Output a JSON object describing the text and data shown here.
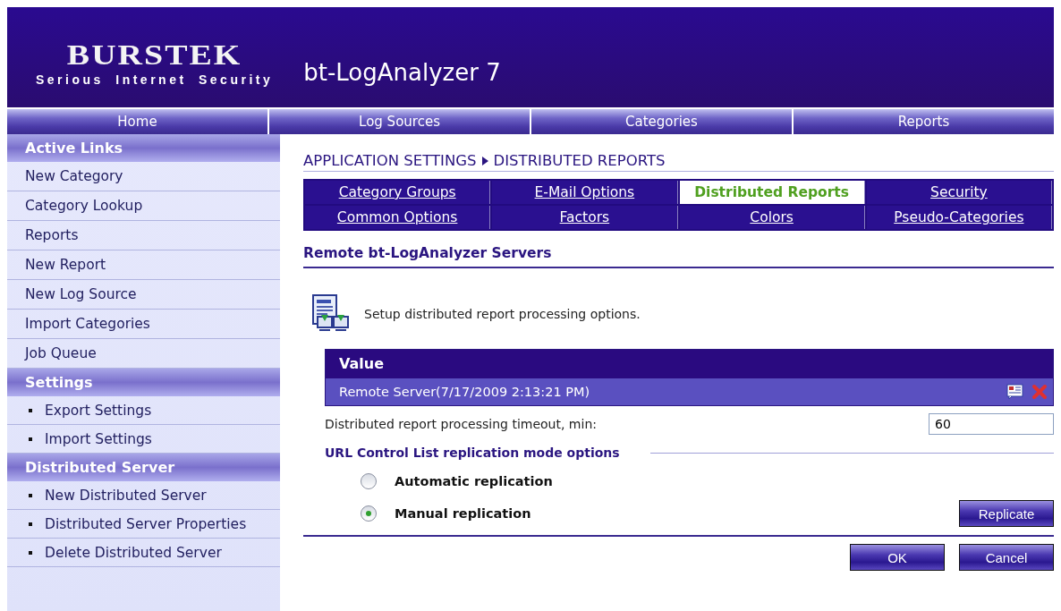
{
  "header": {
    "logo": "BURSTEK",
    "tagline": "Serious Internet Security",
    "app_title": "bt-LogAnalyzer 7"
  },
  "nav": [
    {
      "label": "Home"
    },
    {
      "label": "Log Sources"
    },
    {
      "label": "Categories"
    },
    {
      "label": "Reports"
    }
  ],
  "sidebar": [
    {
      "kind": "header",
      "label": "Active Links"
    },
    {
      "kind": "link",
      "label": "New Category"
    },
    {
      "kind": "link",
      "label": "Category Lookup"
    },
    {
      "kind": "link",
      "label": "Reports"
    },
    {
      "kind": "link",
      "label": "New Report"
    },
    {
      "kind": "link",
      "label": "New Log Source"
    },
    {
      "kind": "link",
      "label": "Import Categories"
    },
    {
      "kind": "link",
      "label": "Job Queue"
    },
    {
      "kind": "header",
      "label": "Settings"
    },
    {
      "kind": "bullet",
      "label": "Export Settings"
    },
    {
      "kind": "bullet",
      "label": "Import Settings"
    },
    {
      "kind": "header",
      "label": "Distributed Server"
    },
    {
      "kind": "bullet",
      "label": "New Distributed Server"
    },
    {
      "kind": "bullet",
      "label": "Distributed Server Properties"
    },
    {
      "kind": "bullet",
      "label": "Delete Distributed Server"
    }
  ],
  "breadcrumb": [
    "APPLICATION SETTINGS",
    "DISTRIBUTED REPORTS"
  ],
  "tabs": [
    {
      "label": "Category Groups",
      "selected": false
    },
    {
      "label": "E-Mail Options",
      "selected": false
    },
    {
      "label": "Distributed Reports",
      "selected": true
    },
    {
      "label": "Security",
      "selected": false
    },
    {
      "label": "Common Options",
      "selected": false
    },
    {
      "label": "Factors",
      "selected": false
    },
    {
      "label": "Colors",
      "selected": false
    },
    {
      "label": "Pseudo-Categories",
      "selected": false
    }
  ],
  "section_title": "Remote bt-LogAnalyzer Servers",
  "intro": "Setup distributed report processing options.",
  "table": {
    "header": "Value",
    "rows": [
      {
        "value": "Remote Server(7/17/2009 2:13:21 PM)"
      }
    ]
  },
  "timeout": {
    "label": "Distributed report processing timeout, min:",
    "value": "60"
  },
  "replication": {
    "title": "URL Control List replication mode options",
    "options": [
      {
        "label": "Automatic replication",
        "selected": false
      },
      {
        "label": "Manual replication",
        "selected": true
      }
    ],
    "button": "Replicate"
  },
  "buttons": [
    "OK",
    "Cancel"
  ]
}
